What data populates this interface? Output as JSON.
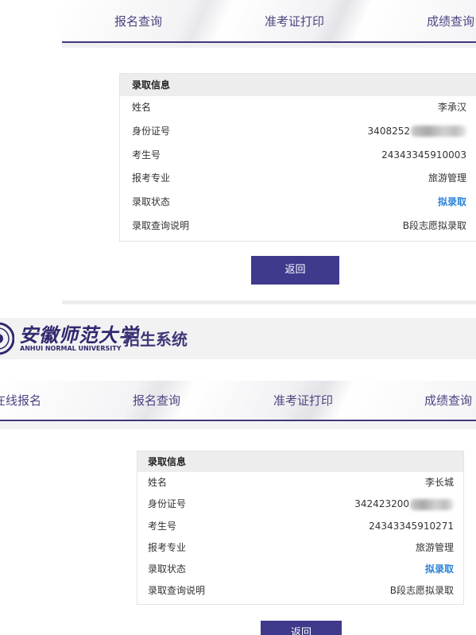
{
  "top": {
    "nav": [
      "报名查询",
      "准考证打印",
      "成绩查询"
    ],
    "card_title": "录取信息",
    "rows": [
      {
        "label": "姓名",
        "value": "李承汉"
      },
      {
        "label": "身份证号",
        "value": "3408252"
      },
      {
        "label": "考生号",
        "value": "24343345910003"
      },
      {
        "label": "报考专业",
        "value": "旅游管理"
      },
      {
        "label": "录取状态",
        "value": "拟录取"
      },
      {
        "label": "录取查询说明",
        "value": "B段志愿拟录取"
      }
    ],
    "button": "返回"
  },
  "bottom": {
    "logo_text": "安徽师范大学",
    "logo_en": "ANHUI NORMAL UNIVERSITY",
    "system_title": "招生系统",
    "nav": [
      "在线报名",
      "报名查询",
      "准考证打印",
      "成绩查询"
    ],
    "card_title": "录取信息",
    "rows": [
      {
        "label": "姓名",
        "value": "李长城"
      },
      {
        "label": "身份证号",
        "value": "342423200"
      },
      {
        "label": "考生号",
        "value": "24343345910271"
      },
      {
        "label": "报考专业",
        "value": "旅游管理"
      },
      {
        "label": "录取状态",
        "value": "拟录取"
      },
      {
        "label": "录取查询说明",
        "value": "B段志愿拟录取"
      }
    ],
    "button": "返回"
  },
  "colors": {
    "accent": "#3f3a8c",
    "status": "#2a83d8",
    "nav_text": "#4b4580"
  }
}
